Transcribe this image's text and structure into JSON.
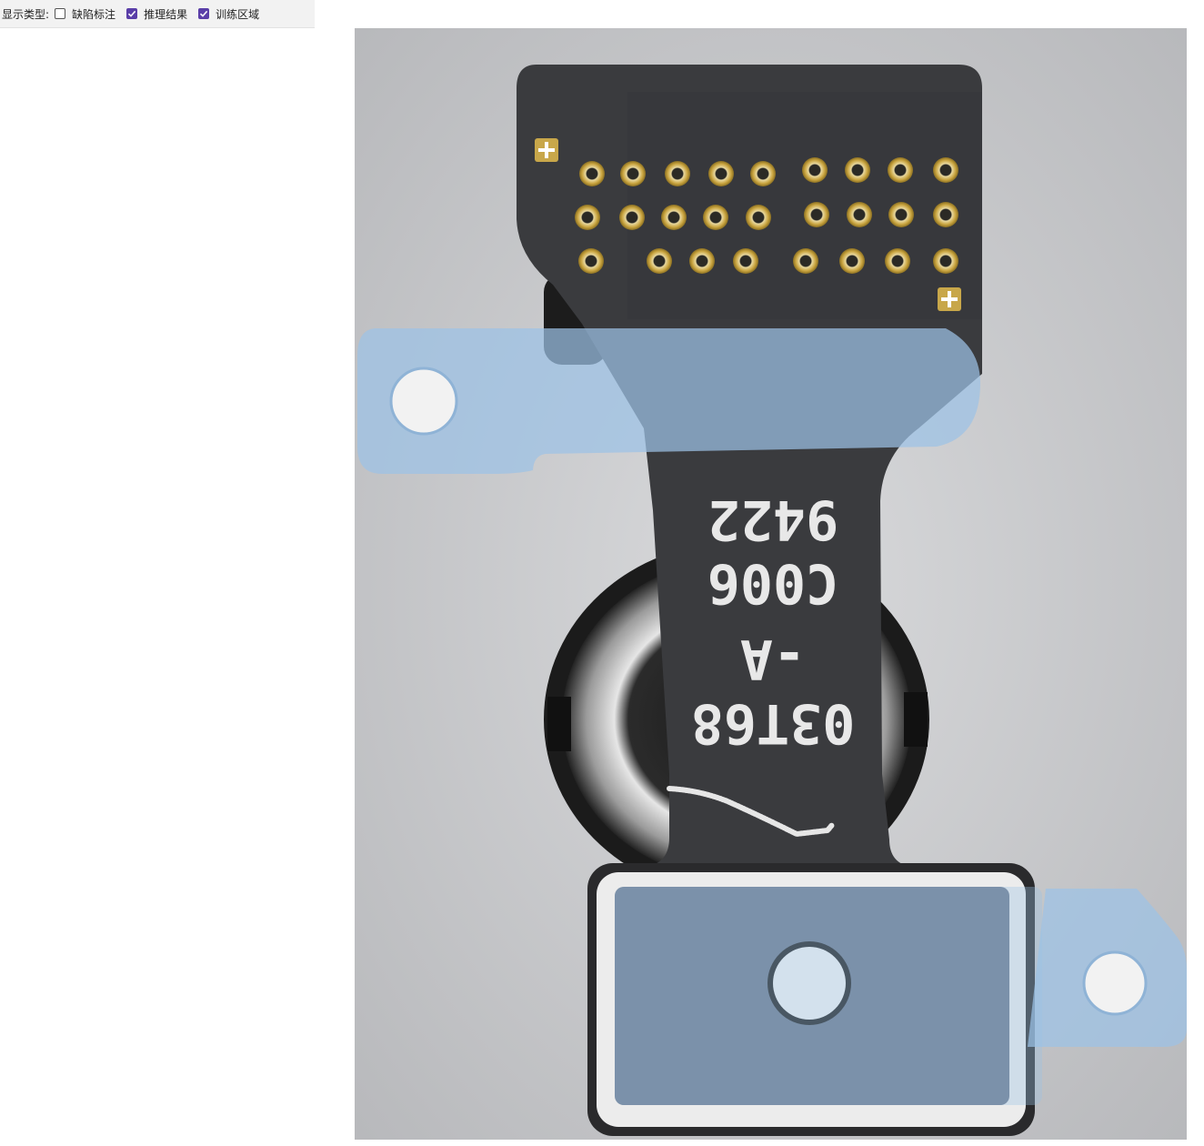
{
  "toolbar": {
    "label": "显示类型:",
    "options": [
      {
        "label": "缺陷标注",
        "checked": false
      },
      {
        "label": "推理结果",
        "checked": true
      },
      {
        "label": "训练区域",
        "checked": true
      }
    ]
  },
  "image": {
    "part_marking": {
      "line1": "9422",
      "line2": "C006",
      "line3": "-A",
      "line4": "03T68"
    }
  },
  "colors": {
    "accent": "#5a3ea8",
    "background_gray": "#c9cacd",
    "flex_dark": "#3a3b3e",
    "gold": "#c8a74a",
    "blue_film": "#9cc2e6",
    "defect_highlight": "#e6e6e6"
  }
}
